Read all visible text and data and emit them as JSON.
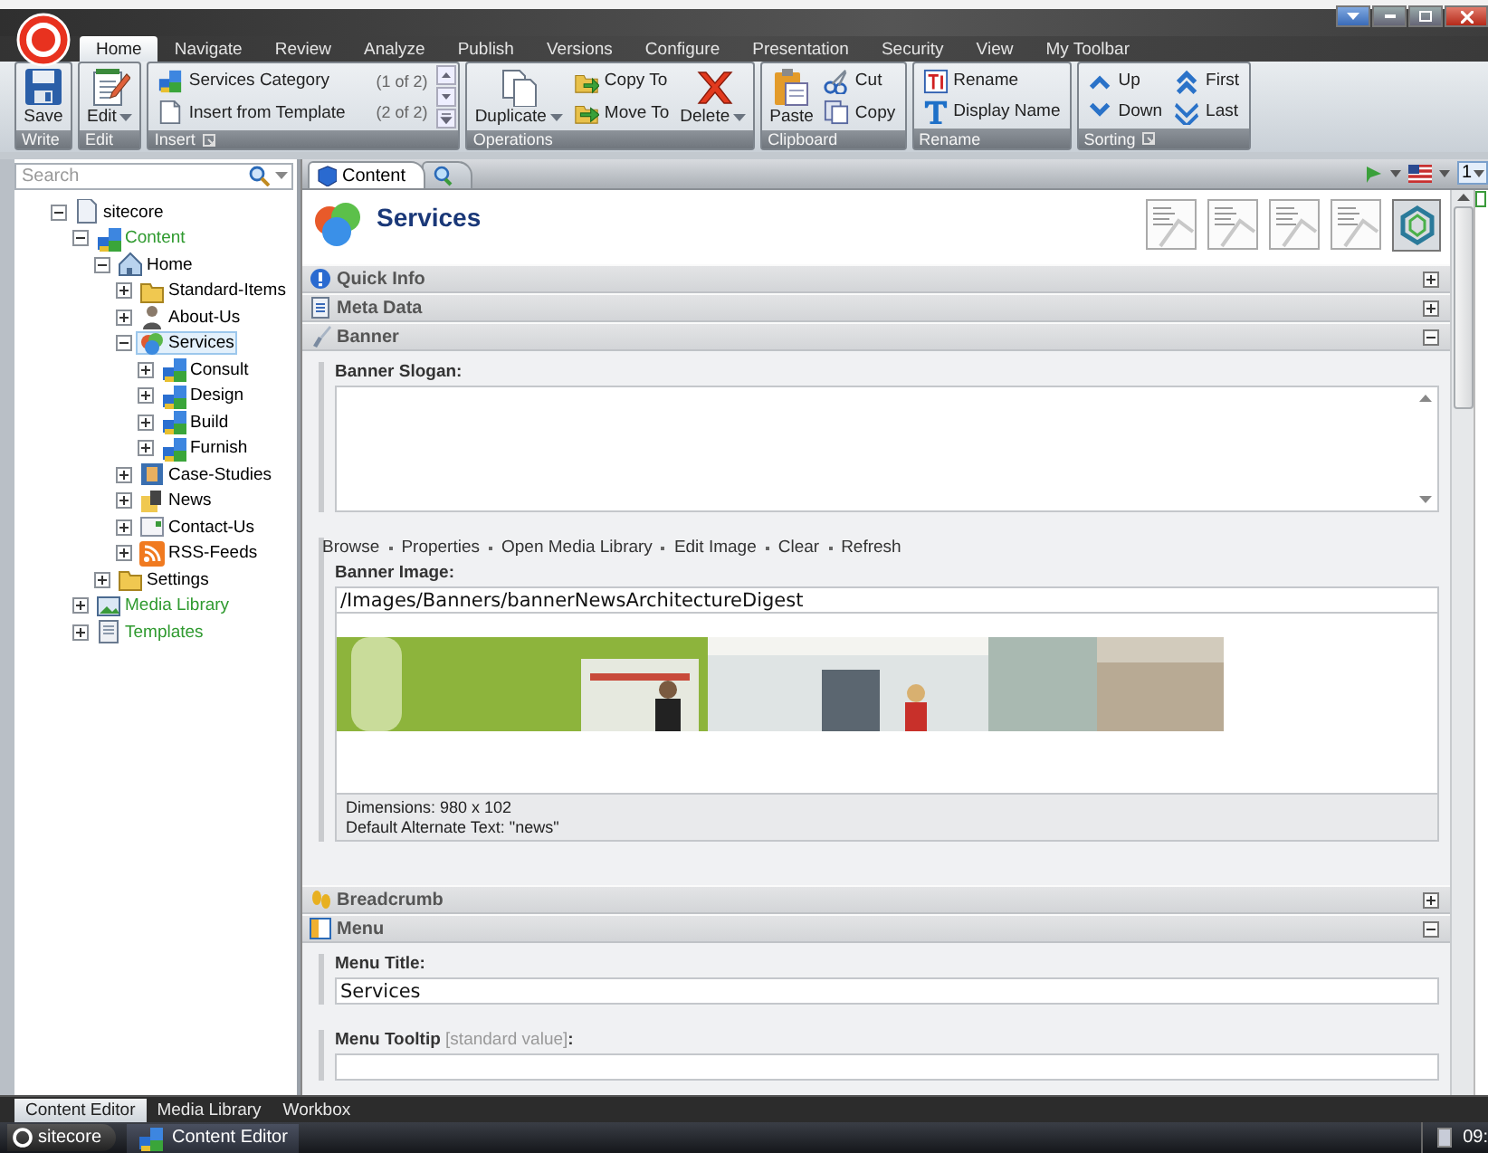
{
  "ribbon": {
    "tabs": [
      {
        "label": "Home",
        "selected": true
      },
      {
        "label": "Navigate",
        "selected": false
      },
      {
        "label": "Review",
        "selected": false
      },
      {
        "label": "Analyze",
        "selected": false
      },
      {
        "label": "Publish",
        "selected": false
      },
      {
        "label": "Versions",
        "selected": false
      },
      {
        "label": "Configure",
        "selected": false
      },
      {
        "label": "Presentation",
        "selected": false
      },
      {
        "label": "Security",
        "selected": false
      },
      {
        "label": "View",
        "selected": false
      },
      {
        "label": "My Toolbar",
        "selected": false
      }
    ],
    "groups": [
      {
        "title": "Write",
        "launcher": false,
        "buttons": [
          {
            "label": "Save",
            "kind": "large",
            "dropdown": false
          }
        ]
      },
      {
        "title": "Edit",
        "launcher": false,
        "buttons": [
          {
            "label": "Edit",
            "kind": "large",
            "dropdown": true
          }
        ]
      },
      {
        "title": "Insert",
        "launcher": true,
        "buttons": [
          {
            "label": "Services Category",
            "kind": "gallery",
            "count": "(1 of 2)"
          },
          {
            "label": "Insert from Template",
            "kind": "gallery",
            "count": "(2 of 2)"
          }
        ]
      },
      {
        "title": "Operations",
        "launcher": false,
        "buttons": [
          {
            "label": "Duplicate",
            "kind": "large",
            "dropdown": true
          },
          {
            "label": "Copy To",
            "kind": "small"
          },
          {
            "label": "Move To",
            "kind": "small"
          },
          {
            "label": "Delete",
            "kind": "large",
            "dropdown": true
          }
        ]
      },
      {
        "title": "Clipboard",
        "launcher": false,
        "buttons": [
          {
            "label": "Paste",
            "kind": "large",
            "dropdown": false
          },
          {
            "label": "Cut",
            "kind": "small"
          },
          {
            "label": "Copy",
            "kind": "small"
          }
        ]
      },
      {
        "title": "Rename",
        "launcher": false,
        "buttons": [
          {
            "label": "Rename",
            "kind": "small"
          },
          {
            "label": "Display Name",
            "kind": "small"
          }
        ]
      },
      {
        "title": "Sorting",
        "launcher": true,
        "buttons": [
          {
            "label": "Up",
            "kind": "small"
          },
          {
            "label": "Down",
            "kind": "small"
          },
          {
            "label": "First",
            "kind": "small"
          },
          {
            "label": "Last",
            "kind": "small"
          }
        ]
      }
    ]
  },
  "search": {
    "placeholder": "Search"
  },
  "tree": {
    "items": [
      {
        "label": "sitecore",
        "expanded": true,
        "selected": false,
        "color": "#000000",
        "children": [
          {
            "label": "Content",
            "expanded": true,
            "selected": false,
            "color": "#2f9a2f",
            "children": [
              {
                "label": "Home",
                "expanded": true,
                "selected": false,
                "color": "#000000",
                "children": [
                  {
                    "label": "Standard-Items",
                    "expanded": false,
                    "selected": false,
                    "color": "#000000"
                  },
                  {
                    "label": "About-Us",
                    "expanded": false,
                    "selected": false,
                    "color": "#000000"
                  },
                  {
                    "label": "Services",
                    "expanded": true,
                    "selected": true,
                    "color": "#000000",
                    "children": [
                      {
                        "label": "Consult",
                        "expanded": false,
                        "selected": false,
                        "color": "#000000"
                      },
                      {
                        "label": "Design",
                        "expanded": false,
                        "selected": false,
                        "color": "#000000"
                      },
                      {
                        "label": "Build",
                        "expanded": false,
                        "selected": false,
                        "color": "#000000"
                      },
                      {
                        "label": "Furnish",
                        "expanded": false,
                        "selected": false,
                        "color": "#000000"
                      }
                    ]
                  },
                  {
                    "label": "Case-Studies",
                    "expanded": false,
                    "selected": false,
                    "color": "#000000"
                  },
                  {
                    "label": "News",
                    "expanded": false,
                    "selected": false,
                    "color": "#000000"
                  },
                  {
                    "label": "Contact-Us",
                    "expanded": false,
                    "selected": false,
                    "color": "#000000"
                  },
                  {
                    "label": "RSS-Feeds",
                    "expanded": false,
                    "selected": false,
                    "color": "#000000"
                  }
                ]
              },
              {
                "label": "Settings",
                "expanded": false,
                "selected": false,
                "color": "#000000"
              }
            ]
          },
          {
            "label": "Media Library",
            "expanded": false,
            "selected": false,
            "color": "#2f9a2f"
          },
          {
            "label": "Templates",
            "expanded": false,
            "selected": false,
            "color": "#2f9a2f"
          }
        ]
      }
    ]
  },
  "editor": {
    "tabs": [
      {
        "label": "Content",
        "selected": true
      },
      {
        "selected": false
      }
    ],
    "version": "1",
    "item_title": "Services",
    "sections": [
      {
        "title": "Quick Info",
        "expanded": false
      },
      {
        "title": "Meta Data",
        "expanded": false
      },
      {
        "title": "Banner",
        "expanded": true,
        "fields": [
          {
            "kind": "memo",
            "label": "Banner Slogan:"
          },
          {
            "label": "Banner Image:",
            "actions": [
              "Browse",
              "Properties",
              "Open Media Library",
              "Edit Image",
              "Clear",
              "Refresh"
            ],
            "value": "/Images/Banners/bannerNewsArchitectureDigest",
            "details": [
              "Dimensions: 980 x 102",
              "Default Alternate Text: \"news\""
            ]
          }
        ]
      },
      {
        "title": "Breadcrumb",
        "expanded": false
      },
      {
        "title": "Menu",
        "expanded": true,
        "fields": [
          {
            "kind": "text",
            "label": "Menu Title:",
            "value": "Services"
          },
          {
            "kind": "text",
            "label": "Menu Tooltip",
            "note": "[standard value]",
            "label_end": ":"
          }
        ]
      }
    ]
  },
  "bottom_tabs": [
    {
      "label": "Content Editor",
      "selected": true
    },
    {
      "label": "Media Library",
      "selected": false
    },
    {
      "label": "Workbox",
      "selected": false
    }
  ],
  "taskbar": {
    "start": "sitecore",
    "tasks": [
      {
        "label": "Content Editor",
        "selected": true
      }
    ],
    "clock": "09:"
  }
}
